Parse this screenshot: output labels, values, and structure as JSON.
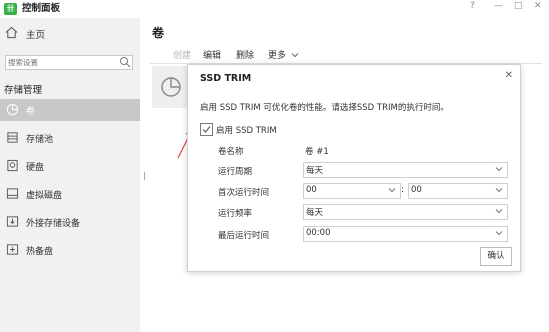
{
  "app": {
    "logo_text": "卌",
    "title": "控制面板"
  },
  "window_controls": [
    "?",
    "—",
    "□",
    "✕"
  ],
  "sidebar": {
    "home_label": "主页",
    "search_placeholder": "搜索设置",
    "section_title": "存储管理",
    "items": [
      {
        "label": "卷",
        "icon": "pie-chart-icon",
        "active": true
      },
      {
        "label": "存储池",
        "icon": "storage-pool-icon"
      },
      {
        "label": "硬盘",
        "icon": "disk-icon"
      },
      {
        "label": "虚拟磁盘",
        "icon": "virtual-disk-icon"
      },
      {
        "label": "外接存储设备",
        "icon": "external-storage-icon"
      },
      {
        "label": "热备盘",
        "icon": "hot-spare-icon"
      }
    ]
  },
  "main": {
    "title": "卷",
    "toolbar": {
      "create": "创建",
      "edit": "编辑",
      "delete": "删除",
      "more": "更多"
    }
  },
  "dialog": {
    "title": "SSD TRIM",
    "description": "启用 SSD TRIM 可优化卷的性能。请选择SSD TRIM的执行时间。",
    "enable_label": "启用 SSD TRIM",
    "enabled": true,
    "fields": {
      "volume_name_label": "卷名称",
      "volume_name_value": "卷 #1",
      "run_period_label": "运行周期",
      "run_period_value": "每天",
      "first_run_label": "首次运行时间",
      "first_run_hour": "00",
      "first_run_minute": "00",
      "frequency_label": "运行频率",
      "frequency_value": "每天",
      "last_run_label": "最后运行时间",
      "last_run_value": "00:00"
    },
    "ok_label": "确认"
  },
  "colors": {
    "accent": "#35b34a",
    "annotation_arrow": "#e23a3a",
    "active_nav": "#c8c8c8"
  }
}
